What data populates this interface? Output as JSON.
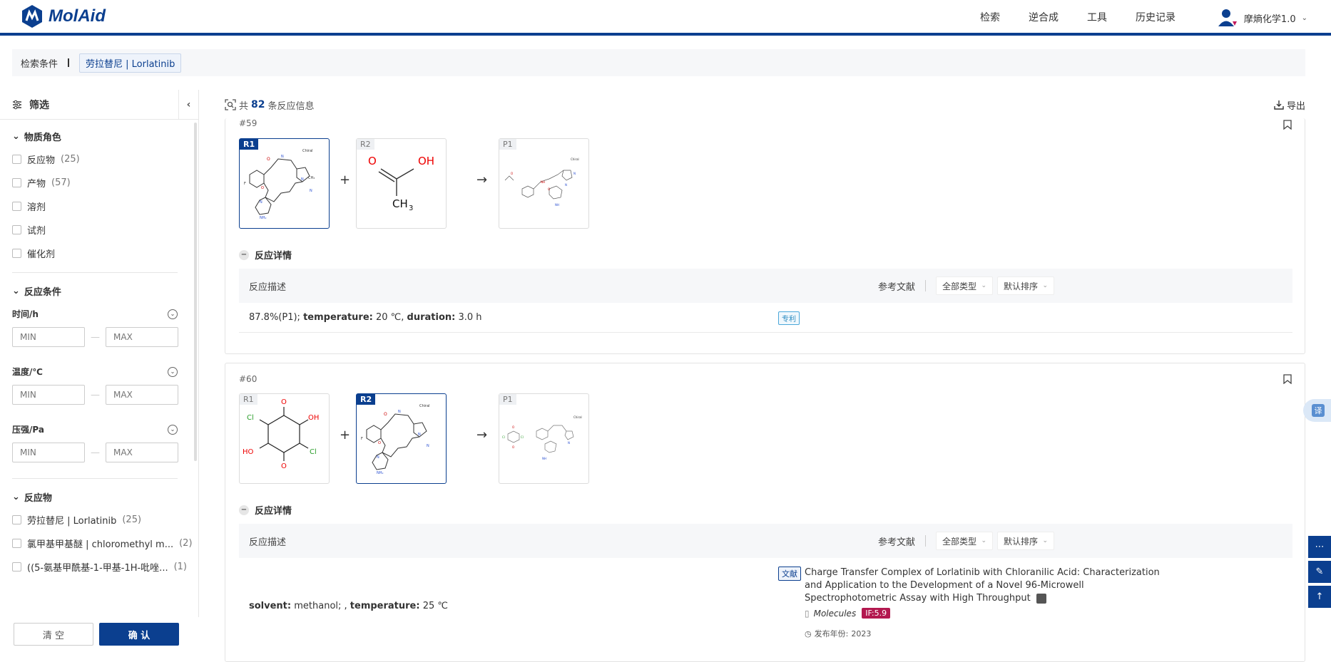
{
  "header": {
    "logo_text": "MolAid",
    "nav": [
      "检索",
      "逆合成",
      "工具",
      "历史记录"
    ],
    "user_name": "摩熵化学1.0"
  },
  "condition_bar": {
    "label": "检索条件",
    "tag": "劳拉替尼 | Lorlatinib"
  },
  "sidebar": {
    "title": "筛选",
    "role_section": "物质角色",
    "roles": [
      {
        "label": "反应物",
        "count": "(25)"
      },
      {
        "label": "产物",
        "count": "(57)"
      },
      {
        "label": "溶剂",
        "count": ""
      },
      {
        "label": "试剂",
        "count": ""
      },
      {
        "label": "催化剂",
        "count": ""
      }
    ],
    "cond_section": "反应条件",
    "ranges": [
      {
        "label": "时间/h",
        "min": "MIN",
        "max": "MAX"
      },
      {
        "label": "温度/℃",
        "min": "MIN",
        "max": "MAX"
      },
      {
        "label": "压强/Pa",
        "min": "MIN",
        "max": "MAX"
      }
    ],
    "reactant_section": "反应物",
    "reactants": [
      {
        "label": "劳拉替尼 | Lorlatinib",
        "count": "(25)"
      },
      {
        "label": "氯甲基甲基醚 | chloromethyl m...",
        "count": "(2)"
      },
      {
        "label": "((5-氨基甲酰基-1-甲基-1H-吡唑...",
        "count": "(1)"
      }
    ],
    "clear_label": "清 空",
    "ok_label": "确 认"
  },
  "main": {
    "count_prefix": "共",
    "count": "82",
    "count_suffix": "条反应信息",
    "export_label": "导出"
  },
  "reactions": [
    {
      "id": "#59",
      "r1_label": "R1",
      "r2_label": "R2",
      "p1_label": "P1",
      "detail_title": "反应详情",
      "col_desc": "反应描述",
      "col_ref": "参考文献",
      "filter_type": "全部类型",
      "filter_sort": "默认排序",
      "yield": "87.8%(P1);",
      "temp_key": "temperature:",
      "temp_val": "20 ℃,",
      "dur_key": "duration:",
      "dur_val": "3.0 h",
      "ref_badge": "专利"
    },
    {
      "id": "#60",
      "r1_label": "R1",
      "r2_label": "R2",
      "p1_label": "P1",
      "detail_title": "反应详情",
      "col_desc": "反应描述",
      "col_ref": "参考文献",
      "filter_type": "全部类型",
      "filter_sort": "默认排序",
      "solvent_key": "solvent:",
      "solvent_val": "methanol; ,",
      "temp_key": "temperature:",
      "temp_val": "25 ℃",
      "ref_badge": "文献",
      "ref_title": "Charge Transfer Complex of Lorlatinib with Chloranilic Acid: Characterization and Application to the Development of a Novel 96-Microwell Spectrophotometric Assay with High Throughput",
      "journal": "Molecules",
      "impact": "IF:5.9",
      "year_label": "发布年份:",
      "year": "2023"
    }
  ],
  "floating": {
    "translate": "译"
  },
  "colors": {
    "brand": "#0b3f8f",
    "impact_badge": "#b3184f"
  }
}
